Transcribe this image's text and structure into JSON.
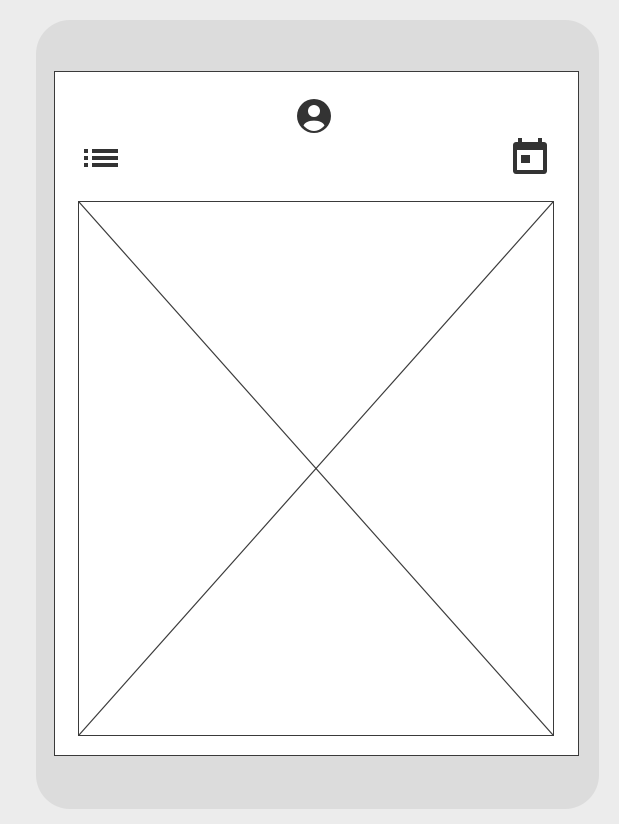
{
  "app": {
    "type": "mobile-wireframe"
  },
  "header": {
    "menu_icon": "list-menu-icon",
    "profile_icon": "account-circle-icon",
    "calendar_icon": "calendar-icon"
  },
  "main": {
    "image_placeholder": "image-placeholder"
  },
  "colors": {
    "page_background": "#ececec",
    "device_frame": "#dcdcdc",
    "screen_background": "#ffffff",
    "stroke": "#3a3a3a",
    "icon": "#333333"
  }
}
